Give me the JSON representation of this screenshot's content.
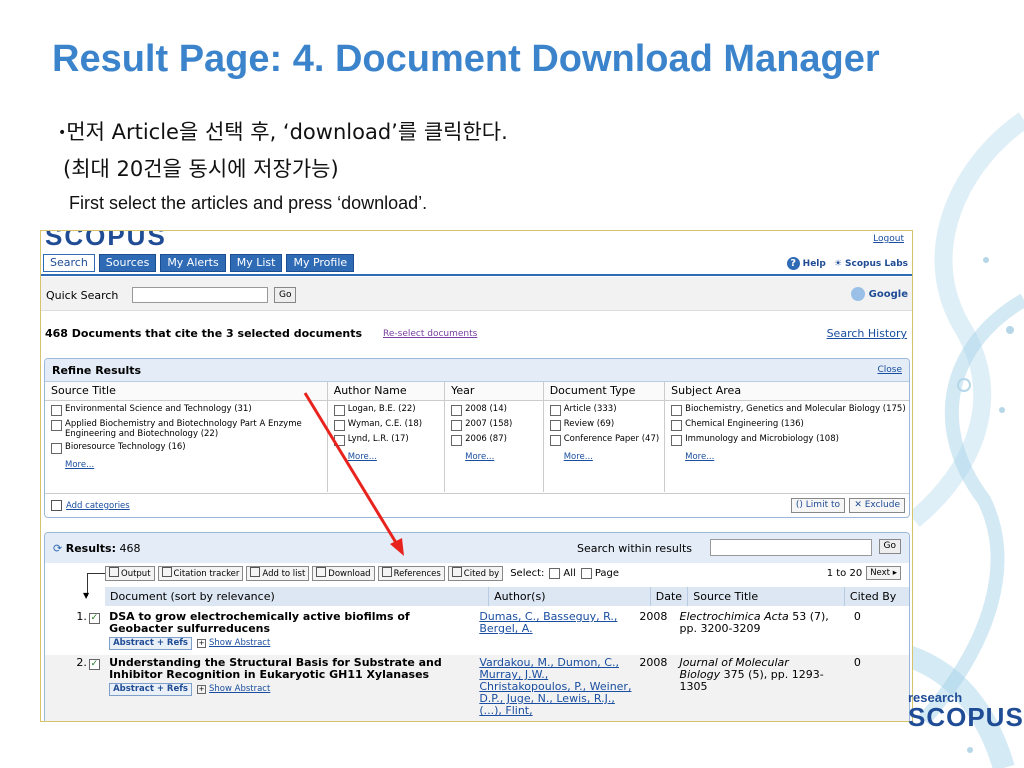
{
  "slide": {
    "title": "Result Page: 4. Document Download Manager",
    "bullet_text": "먼저 Article을 선택 후, ‘download’를 클릭한다.",
    "bullet_subtext": "(최대 20건을 동시에 저장가능)",
    "english_text": "First select the articles and press ‘download’."
  },
  "scopus": {
    "logo": "SCOPUS",
    "logout": "Logout",
    "nav_tabs": [
      "Search",
      "Sources",
      "My Alerts",
      "My List",
      "My Profile"
    ],
    "help": "Help",
    "labs": "Scopus Labs",
    "quick_search_label": "Quick Search",
    "go_label": "Go",
    "google_label": "Google",
    "docs_count_text": "468 Documents that cite the 3 selected documents",
    "reselect_link": "Re-select documents",
    "search_history": "Search History",
    "refine": {
      "title": "Refine Results",
      "close": "Close",
      "columns": [
        {
          "header": "Source Title",
          "items": [
            "Environmental Science and Technology (31)",
            "Applied Biochemistry and Biotechnology Part A Enzyme Engineering and Biotechnology (22)",
            "Bioresource Technology (16)"
          ]
        },
        {
          "header": "Author Name",
          "items": [
            "Logan, B.E. (22)",
            "Wyman, C.E. (18)",
            "Lynd, L.R. (17)"
          ]
        },
        {
          "header": "Year",
          "items": [
            "2008 (14)",
            "2007 (158)",
            "2006 (87)"
          ]
        },
        {
          "header": "Document Type",
          "items": [
            "Article (333)",
            "Review (69)",
            "Conference Paper (47)"
          ]
        },
        {
          "header": "Subject Area",
          "items": [
            "Biochemistry, Genetics and Molecular Biology (175)",
            "Chemical Engineering (136)",
            "Immunology and Microbiology (108)"
          ]
        }
      ],
      "more": "More...",
      "add_categories": "Add categories",
      "limit_to": "Limit to",
      "exclude": "Exclude"
    },
    "results": {
      "label": "Results:",
      "count": "468",
      "search_within": "Search within results",
      "go_label": "Go",
      "tools": [
        "Output",
        "Citation tracker",
        "Add to list",
        "Download",
        "References",
        "Cited by"
      ],
      "select_label": "Select:",
      "select_all": "All",
      "select_page": "Page",
      "range": "1 to 20",
      "next": "Next",
      "headers": [
        "Document (sort by relevance)",
        "Author(s)",
        "Date",
        "Source Title",
        "Cited By"
      ],
      "abstract_refs": "Abstract + Refs",
      "show_abstract": "Show Abstract",
      "rows": [
        {
          "num": "1.",
          "title": "DSA to grow electrochemically active biofilms of Geobacter sulfurreducens",
          "authors": "Dumas, C., Basseguy, R., Bergel, A.",
          "year": "2008",
          "source_journal": "Electrochimica Acta",
          "source_detail": "53 (7), pp. 3200-3209",
          "cited": "0"
        },
        {
          "num": "2.",
          "title": "Understanding the Structural Basis for Substrate and Inhibitor Recognition in Eukaryotic GH11 Xylanases",
          "authors": "Vardakou, M., Dumon, C., Murray, J.W., Christakopoulos, P., Weiner, D.P., Juge, N., Lewis, R.J., (...), Flint,",
          "year": "2008",
          "source_journal": "Journal of Molecular Biology",
          "source_detail": "375 (5), pp. 1293-1305",
          "cited": "0"
        }
      ]
    }
  },
  "branding": {
    "research": "research",
    "scopus": "SCOPUS",
    "tm": "TM"
  },
  "colors": {
    "title_blue": "#3b84cc",
    "nav_blue": "#2f6bb5",
    "link_blue": "#1a4ea0",
    "arrow_red": "#e8231e"
  }
}
